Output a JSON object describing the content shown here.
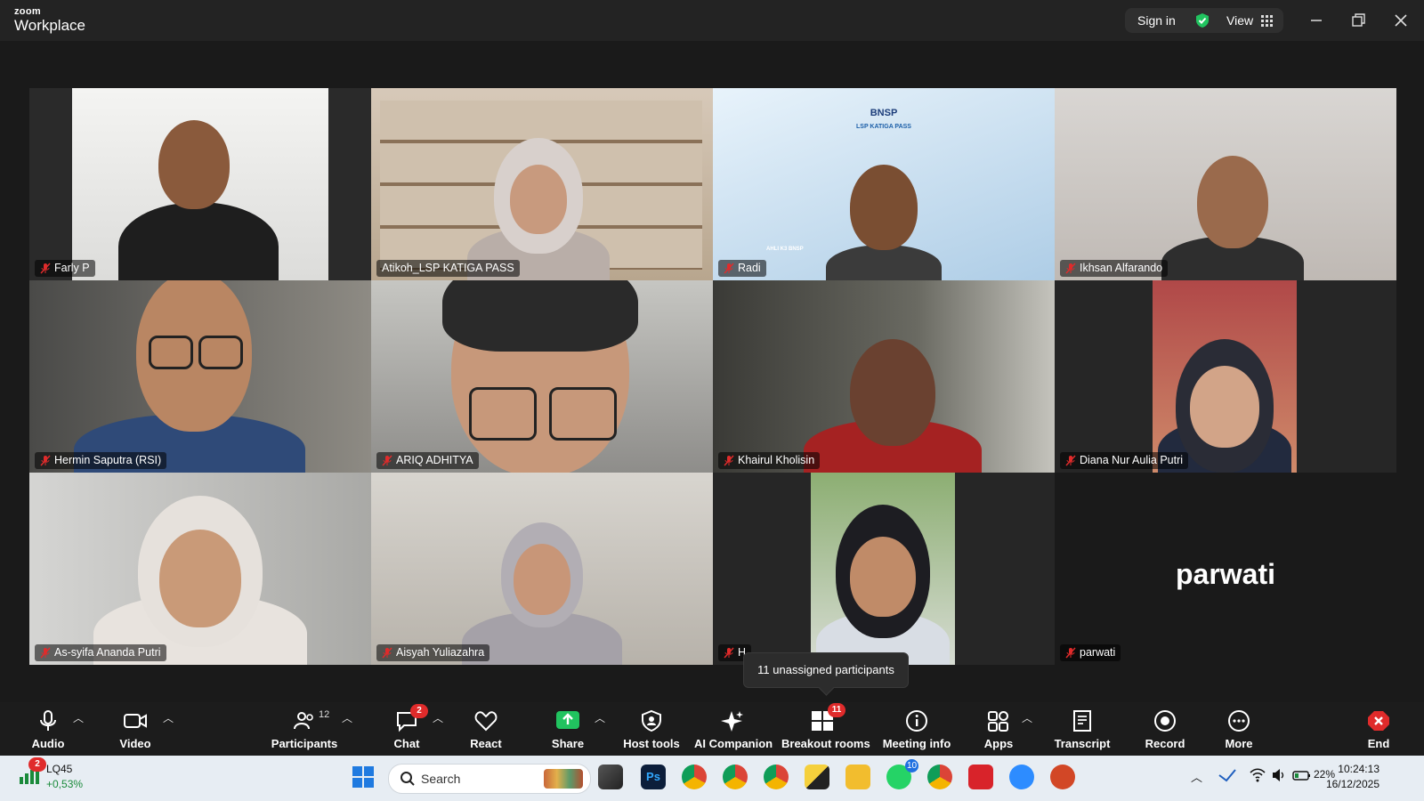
{
  "window": {
    "brand_top": "zoom",
    "brand_bottom": "Workplace",
    "sign_in": "Sign in",
    "view": "View"
  },
  "tiles": [
    {
      "name": "Farly P"
    },
    {
      "name": "Atikoh_LSP KATIGA PASS"
    },
    {
      "name": "Radi",
      "bg_text_logo": "BNSP",
      "bg_text_sub": "LSP KATIGA PASS",
      "bg_text_bottom": "AHLI K3 BNSP"
    },
    {
      "name": "Ikhsan Alfarando"
    },
    {
      "name": "Hermin Saputra (RSI)"
    },
    {
      "name": "ARIQ ADHITYA"
    },
    {
      "name": "Khairul Kholisin"
    },
    {
      "name": "Diana Nur Aulia Putri"
    },
    {
      "name": "As-syifa Ananda Putri"
    },
    {
      "name": "Aisyah Yuliazahra"
    },
    {
      "name": "H"
    },
    {
      "name": "parwati",
      "big_name": "parwati"
    }
  ],
  "tooltip": "11 unassigned participants",
  "toolbar": {
    "audio": "Audio",
    "video": "Video",
    "participants": "Participants",
    "participants_count": "12",
    "chat": "Chat",
    "chat_badge": "2",
    "react": "React",
    "share": "Share",
    "host_tools": "Host tools",
    "ai_companion": "AI Companion",
    "breakout_rooms": "Breakout rooms",
    "breakout_badge": "11",
    "meeting_info": "Meeting info",
    "apps": "Apps",
    "transcript": "Transcript",
    "record": "Record",
    "more": "More",
    "end": "End"
  },
  "taskbar": {
    "stock_badge": "2",
    "stock_name": "LQ45",
    "stock_change": "+0,53%",
    "search_placeholder": "Search",
    "whatsapp_badge": "10",
    "battery": "22%",
    "time": "10:24:13",
    "date": "16/12/2025"
  },
  "colors": {
    "active_speaker": "#21c35f",
    "share": "#21c35f",
    "end": "#e02b2b",
    "badge": "#e02b2b"
  }
}
